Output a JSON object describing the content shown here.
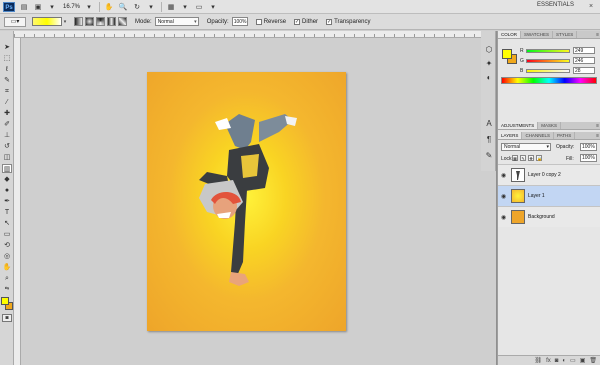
{
  "app": {
    "logo": "Ps",
    "zoom": "16.7%",
    "workspace": "ESSENTIALS",
    "close_icon": "×"
  },
  "options": {
    "mode_label": "Mode:",
    "mode_value": "Normal",
    "opacity_label": "Opacity:",
    "opacity_value": "100%",
    "reverse_label": "Reverse",
    "dither_label": "Dither",
    "transparency_label": "Transparency",
    "reverse_checked": false,
    "dither_checked": true,
    "transparency_checked": true
  },
  "colors": {
    "foreground": "#ffff00",
    "background": "#f0a81c",
    "canvas_center": "#fff23a",
    "canvas_edge": "#eea52a"
  },
  "color_panel": {
    "tabs": [
      "COLOR",
      "SWATCHES",
      "STYLES"
    ],
    "r_label": "R",
    "r_value": "249",
    "g_label": "G",
    "g_value": "246",
    "b_label": "B",
    "b_value": "28"
  },
  "adjustments": {
    "tabs": [
      "ADJUSTMENTS",
      "MASKS"
    ]
  },
  "layers_panel": {
    "tabs": [
      "LAYERS",
      "CHANNELS",
      "PATHS"
    ],
    "blend_mode": "Normal",
    "opacity_label": "Opacity:",
    "opacity_value": "100%",
    "lock_label": "Lock:",
    "fill_label": "Fill:",
    "fill_value": "100%",
    "layers": [
      {
        "name": "Layer 0 copy 2",
        "selected": false
      },
      {
        "name": "Layer 1",
        "selected": true
      },
      {
        "name": "Background",
        "selected": false
      }
    ]
  }
}
